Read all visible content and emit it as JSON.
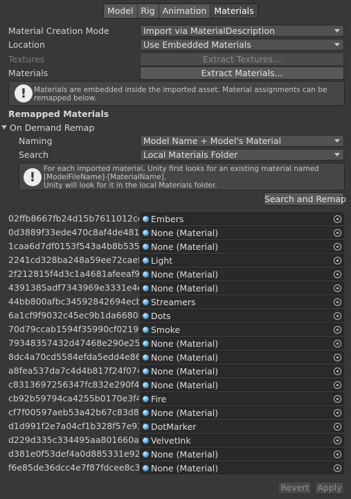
{
  "tabs": [
    {
      "label": "Model"
    },
    {
      "label": "Rig"
    },
    {
      "label": "Animation"
    },
    {
      "label": "Materials",
      "active": true
    }
  ],
  "creation_mode": {
    "label": "Material Creation Mode",
    "value": "Import via MaterialDescription"
  },
  "location": {
    "label": "Location",
    "value": "Use Embedded Materials"
  },
  "textures": {
    "label": "Textures",
    "button": "Extract Textures..."
  },
  "materials": {
    "label": "Materials",
    "button": "Extract Materials..."
  },
  "embedded_help": "Materials are embedded inside the imported asset. Material assignments can be remapped below.",
  "remapped": {
    "title": "Remapped Materials",
    "foldout": "On Demand Remap",
    "naming": {
      "label": "Naming",
      "value": "Model Name + Model's Material"
    },
    "search": {
      "label": "Search",
      "value": "Local Materials Folder"
    },
    "help_line1": "For each imported material, Unity first looks for an existing material named",
    "help_line2": "[ModelFileName]-[MaterialName].",
    "help_line3": "Unity will look for it in the local Materials folder.",
    "search_button": "Search and Remap"
  },
  "material_rows": [
    {
      "name": "02ffb8667fb24d15b7611012cefb1",
      "value": "Embers"
    },
    {
      "name": "0d3889f33ede470c8af4de48133",
      "value": "None (Material)"
    },
    {
      "name": "1caa6d7df0153f543a4b8b5354d",
      "value": "None (Material)"
    },
    {
      "name": "2241cd328ba248a59ee72caef7e",
      "value": "Light"
    },
    {
      "name": "2f212815f4d3c1a4681afeeaf9c6c",
      "value": "None (Material)"
    },
    {
      "name": "4391385adf7343969e3331e4e4",
      "value": "None (Material)"
    },
    {
      "name": "44bb800afbc34592842694ecb0",
      "value": "Streamers"
    },
    {
      "name": "6a1cf9f9032c45ec9b1da6680be",
      "value": "Dots"
    },
    {
      "name": "70d79ccab1594f35990cf021939",
      "value": "Smoke"
    },
    {
      "name": "79348357432d47468e290e25c1",
      "value": "None (Material)"
    },
    {
      "name": "8dc4a70cd5584efda5edd4e860f",
      "value": "None (Material)"
    },
    {
      "name": "a8fea537da7c4d4b817f24f07472",
      "value": "None (Material)"
    },
    {
      "name": "c8313697256347fc832e290f4c0",
      "value": "None (Material)"
    },
    {
      "name": "cb92b59794ca4255b0170e3f42f",
      "value": "Fire"
    },
    {
      "name": "cf7f00597aeb53a42b67c83d863",
      "value": "None (Material)"
    },
    {
      "name": "d1d991f2e7a04cf1b328f57e915e",
      "value": "DotMarker"
    },
    {
      "name": "d229d335c334495aa801660ac8",
      "value": "VelvetInk"
    },
    {
      "name": "d381e0f53def4a0d885331e9200",
      "value": "None (Material)"
    },
    {
      "name": "f6e85de36dcc4e7f87fdcee8c3d2",
      "value": "None (Material)"
    }
  ],
  "footer": {
    "revert": "Revert",
    "apply": "Apply"
  },
  "icons": {
    "info": "exclamation-icon",
    "object_picker": "object-picker-icon",
    "material": "material-sphere-icon"
  }
}
